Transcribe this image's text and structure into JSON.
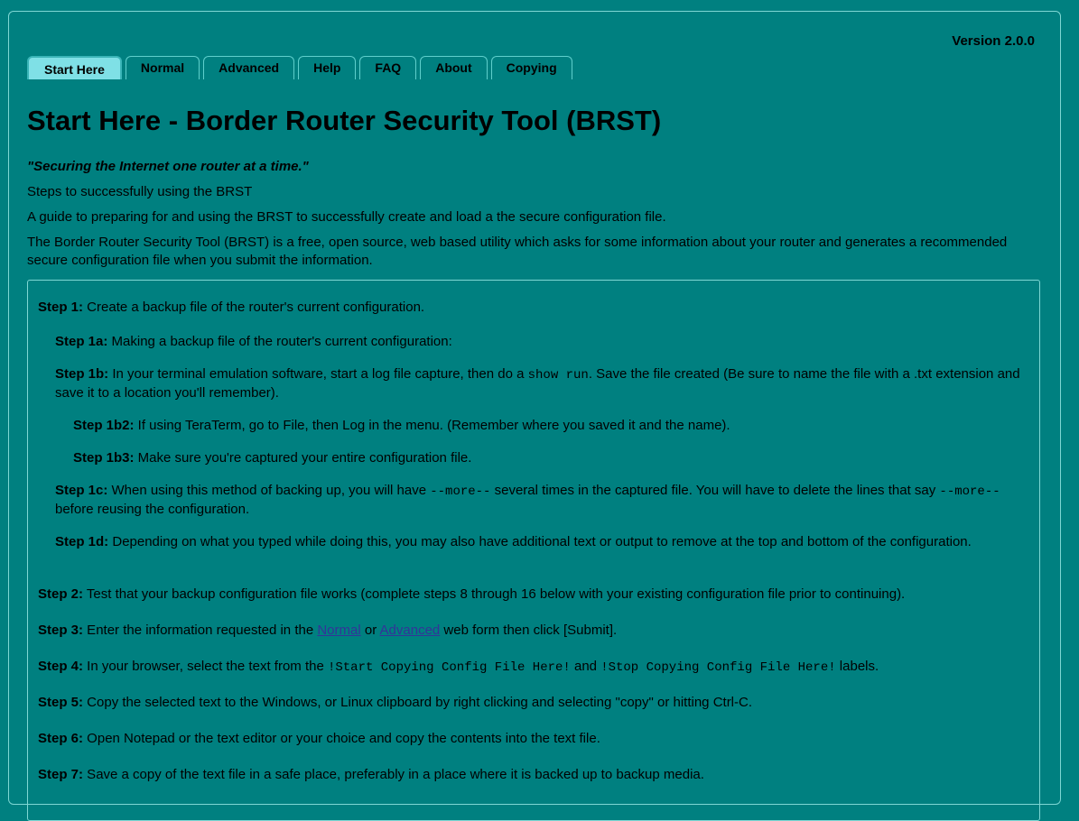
{
  "version": "Version 2.0.0",
  "tabs": [
    {
      "label": "Start Here"
    },
    {
      "label": "Normal"
    },
    {
      "label": "Advanced"
    },
    {
      "label": "Help"
    },
    {
      "label": "FAQ"
    },
    {
      "label": "About"
    },
    {
      "label": "Copying"
    }
  ],
  "title": "Start Here - Border Router Security Tool (BRST)",
  "motto": "\"Securing the Internet one router at a time.\"",
  "intro": [
    "Steps to successfully using the BRST",
    "A guide to preparing for and using the BRST to successfully create and load a the secure configuration file.",
    "The Border Router Security Tool (BRST) is a free, open source, web based utility which asks for some information about your router and generates a recommended secure configuration file when you submit the information."
  ],
  "steps": {
    "s1": {
      "label": "Step 1:",
      "text": " Create a backup file of the router's current configuration."
    },
    "s1a": {
      "label": "Step 1a:",
      "text": " Making a backup file of the router's current configuration:"
    },
    "s1b": {
      "label": "Step 1b:",
      "pre": " In your terminal emulation software, start a log file capture, then do a ",
      "code": "show run",
      "post": ". Save the file created (Be sure to name the file with a .txt extension and save it to a location you'll remember)."
    },
    "s1b2": {
      "label": "Step 1b2:",
      "text": " If using TeraTerm, go to File, then Log in the menu. (Remember where you saved it and the name)."
    },
    "s1b3": {
      "label": "Step 1b3:",
      "text": " Make sure you're captured your entire configuration file."
    },
    "s1c": {
      "label": "Step 1c:",
      "pre": " When using this method of backing up, you will have ",
      "code1": "--more--",
      "mid": " several times in the captured file. You will have to delete the lines that say ",
      "code2": "--more--",
      "post": " before reusing the configuration."
    },
    "s1d": {
      "label": "Step 1d:",
      "text": " Depending on what you typed while doing this, you may also have additional text or output to remove at the top and bottom of the configuration."
    },
    "s2": {
      "label": "Step 2:",
      "text": " Test that your backup configuration file works (complete steps 8 through 16 below with your existing configuration file prior to continuing)."
    },
    "s3": {
      "label": "Step 3:",
      "pre": " Enter the information requested in the ",
      "link1": "Normal",
      "mid": " or ",
      "link2": "Advanced",
      "post": " web form then click [Submit]."
    },
    "s4": {
      "label": "Step 4:",
      "pre": " In your browser, select the text from the ",
      "code1": "!Start Copying Config File Here!",
      "mid": " and ",
      "code2": "!Stop Copying Config File Here!",
      "post": " labels."
    },
    "s5": {
      "label": "Step 5:",
      "text": " Copy the selected text to the Windows, or Linux clipboard by right clicking and selecting \"copy\" or hitting Ctrl-C."
    },
    "s6": {
      "label": "Step 6:",
      "text": " Open Notepad or the text editor or your choice and copy the contents into the text file."
    },
    "s7": {
      "label": "Step 7:",
      "text": " Save a copy of the text file in a safe place, preferably in a place where it is backed up to backup media."
    }
  }
}
